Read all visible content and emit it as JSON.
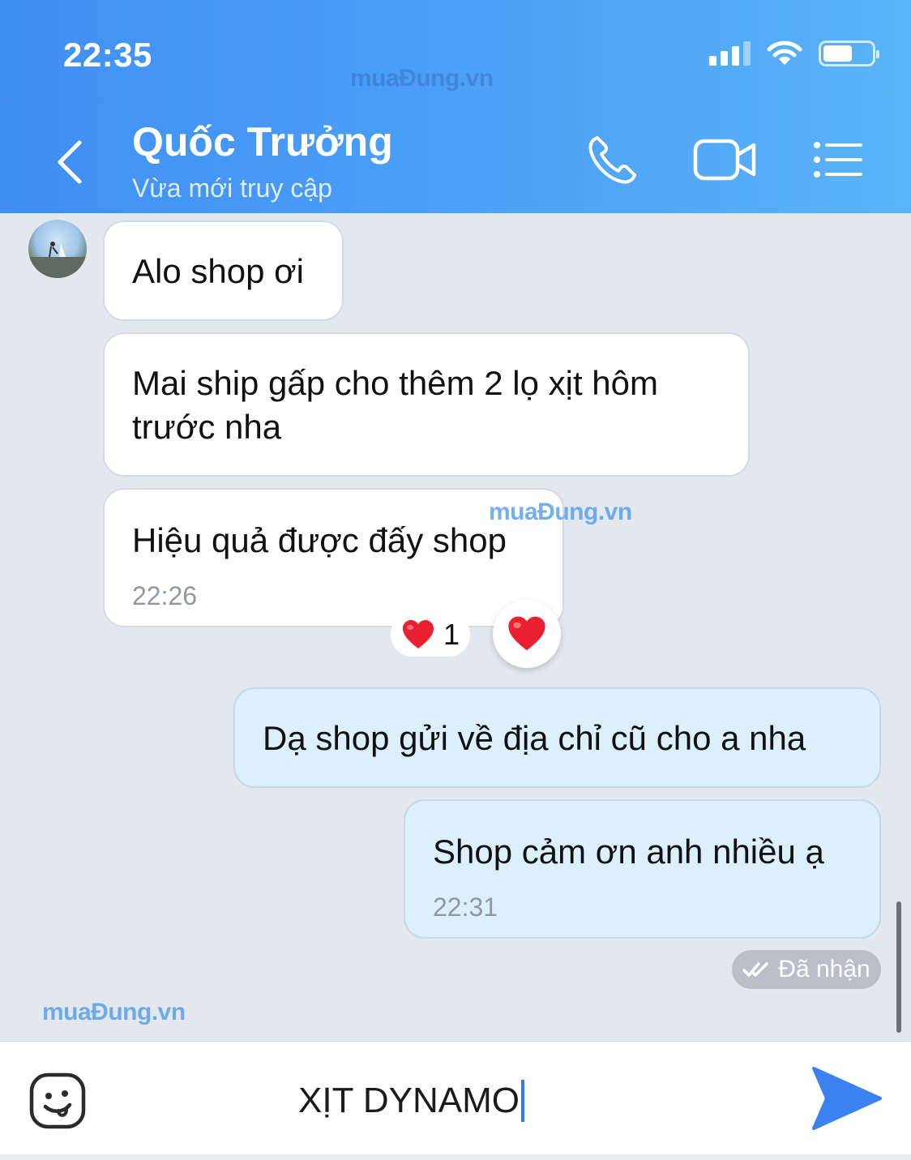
{
  "status_bar": {
    "time": "22:35"
  },
  "header": {
    "contact_name": "Quốc Trưởng",
    "contact_status": "Vừa mới truy cập",
    "watermark": "muaĐung.vn"
  },
  "messages": [
    {
      "direction": "incoming",
      "text": "Alo shop ơi"
    },
    {
      "direction": "incoming",
      "text": "Mai ship gấp cho thêm 2 lọ xịt hôm trước nha"
    },
    {
      "direction": "incoming",
      "text": "Hiệu quả được đấy shop",
      "time": "22:26",
      "reaction": {
        "emoji": "❤️",
        "count": "1"
      }
    },
    {
      "direction": "outgoing",
      "text": "Dạ shop gửi về địa chỉ cũ cho a nha"
    },
    {
      "direction": "outgoing",
      "text": "Shop cảm ơn anh nhiều ạ",
      "time": "22:31"
    }
  ],
  "delivery_status": "Đã nhận",
  "watermarks": {
    "middle": "muaĐung.vn",
    "lower": "muaĐung.vn"
  },
  "composer": {
    "value": "XỊT DYNAMO"
  },
  "colors": {
    "header_gradient_start": "#3f8ff3",
    "header_gradient_end": "#5ab3f7",
    "outgoing_bubble": "#dbeffd",
    "incoming_bubble": "#ffffff",
    "send_icon": "#3b82f0",
    "reaction_heart": "#e8202f"
  }
}
